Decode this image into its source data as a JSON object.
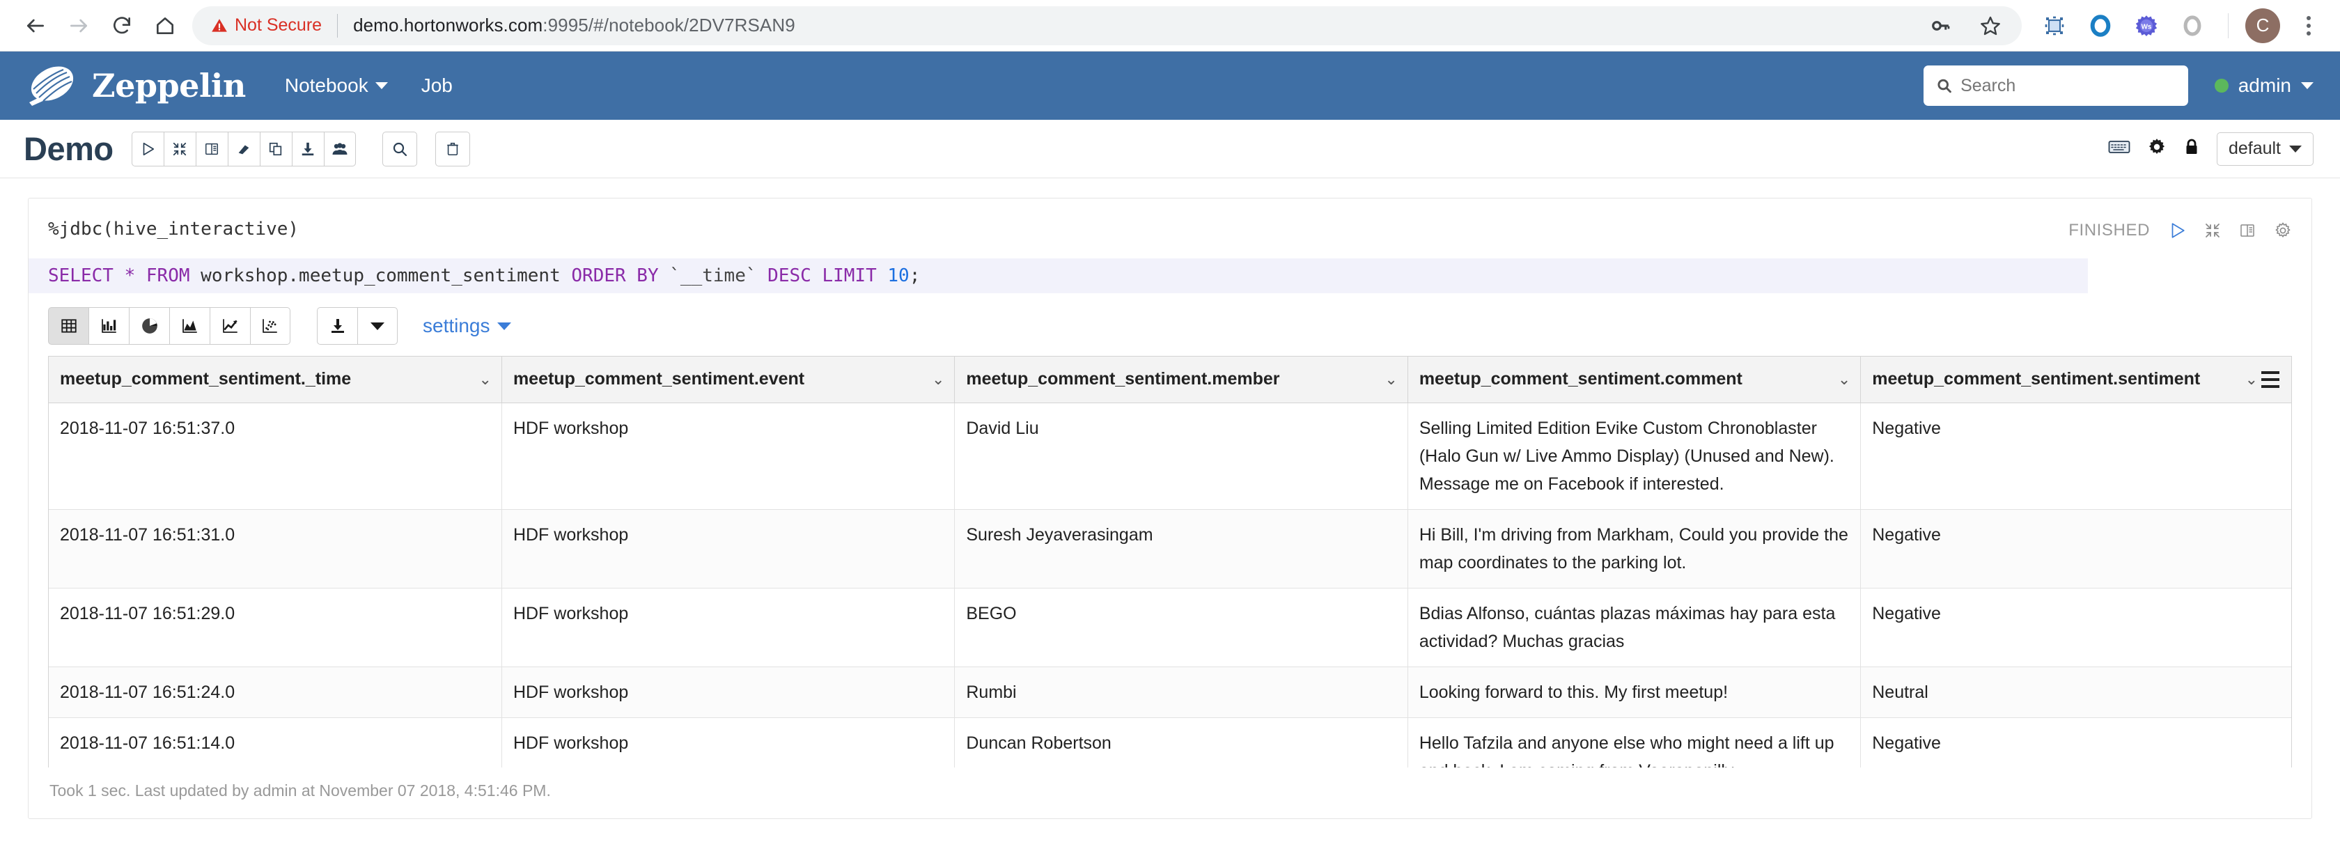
{
  "browser": {
    "back_label": "Back",
    "forward_label": "Forward",
    "reload_label": "Reload",
    "home_label": "Home",
    "security_label": "Not Secure",
    "url_host": "demo.hortonworks.com",
    "url_rest": ":9995/#/notebook/2DV7RSAN9",
    "profile_initial": "C",
    "ext_ws_label": "Ws"
  },
  "navbar": {
    "brand": "Zeppelin",
    "links": [
      {
        "label": "Notebook",
        "has_caret": true
      },
      {
        "label": "Job",
        "has_caret": false
      }
    ],
    "search_placeholder": "Search",
    "search_value": "",
    "user": "admin",
    "status_color": "#5cb85c",
    "bg_color": "#3f6fa5"
  },
  "notebook": {
    "title": "Demo",
    "toolbar_icons": [
      "run-all-icon",
      "collapse-all-icon",
      "book-icon",
      "eraser-icon",
      "clone-icon",
      "export-icon",
      "permissions-icon"
    ],
    "search_icon": "search-icon",
    "trash_icon": "trash-icon",
    "keyboard_icon": "keyboard-icon",
    "settings_icon": "gear-icon",
    "lock_icon": "lock-icon",
    "interpreter_binding": "default"
  },
  "paragraph": {
    "interpreter_line": "%jdbc(hive_interactive)",
    "sql": {
      "full": "SELECT * FROM workshop.meetup_comment_sentiment ORDER BY `__time` DESC LIMIT 10;",
      "tok_select": "SELECT",
      "tok_star": "*",
      "tok_from": "FROM",
      "tok_table": "workshop.meetup_comment_sentiment",
      "tok_orderby": "ORDER BY",
      "tok_col": "`__time`",
      "tok_desc": "DESC",
      "tok_limit": "LIMIT",
      "tok_num": "10",
      "tok_semi": ";"
    },
    "status": "FINISHED",
    "status_icons": [
      "run-icon",
      "collapse-icon",
      "book-icon",
      "gear-icon"
    ],
    "footer": "Took 1 sec. Last updated by admin at November 07 2018, 4:51:46 PM."
  },
  "viz": {
    "modes": [
      {
        "name": "table-viz",
        "active": true
      },
      {
        "name": "bar-chart-viz",
        "active": false
      },
      {
        "name": "pie-chart-viz",
        "active": false
      },
      {
        "name": "area-chart-viz",
        "active": false
      },
      {
        "name": "line-chart-viz",
        "active": false
      },
      {
        "name": "scatter-chart-viz",
        "active": false
      }
    ],
    "download_label": "download-icon",
    "settings_label": "settings"
  },
  "table": {
    "columns": [
      "meetup_comment_sentiment._time",
      "meetup_comment_sentiment.event",
      "meetup_comment_sentiment.member",
      "meetup_comment_sentiment.comment",
      "meetup_comment_sentiment.sentiment"
    ],
    "rows": [
      {
        "time": "2018-11-07 16:51:37.0",
        "event": "HDF workshop",
        "member": "David Liu",
        "comment": "Selling Limited Edition Evike Custom Chronoblaster (Halo Gun w/ Live Ammo Display) (Unused and New). Message me on Facebook if interested.",
        "sentiment": "Negative"
      },
      {
        "time": "2018-11-07 16:51:31.0",
        "event": "HDF workshop",
        "member": "Suresh Jeyaverasingam",
        "comment": "Hi Bill, I'm driving from Markham, Could you provide the map coordinates to the parking lot.",
        "sentiment": "Negative"
      },
      {
        "time": "2018-11-07 16:51:29.0",
        "event": "HDF workshop",
        "member": "BEGO",
        "comment": "Bdias Alfonso, cuántas plazas máximas hay para esta actividad? Muchas gracias",
        "sentiment": "Negative"
      },
      {
        "time": "2018-11-07 16:51:24.0",
        "event": "HDF workshop",
        "member": "Rumbi",
        "comment": "Looking forward to this. My first meetup!",
        "sentiment": "Neutral"
      },
      {
        "time": "2018-11-07 16:51:14.0",
        "event": "HDF workshop",
        "member": "Duncan Robertson",
        "comment": "Hello Tafzila and anyone else who might need a lift up and back. I am coming from Veerapanilly",
        "sentiment": "Negative"
      }
    ]
  }
}
